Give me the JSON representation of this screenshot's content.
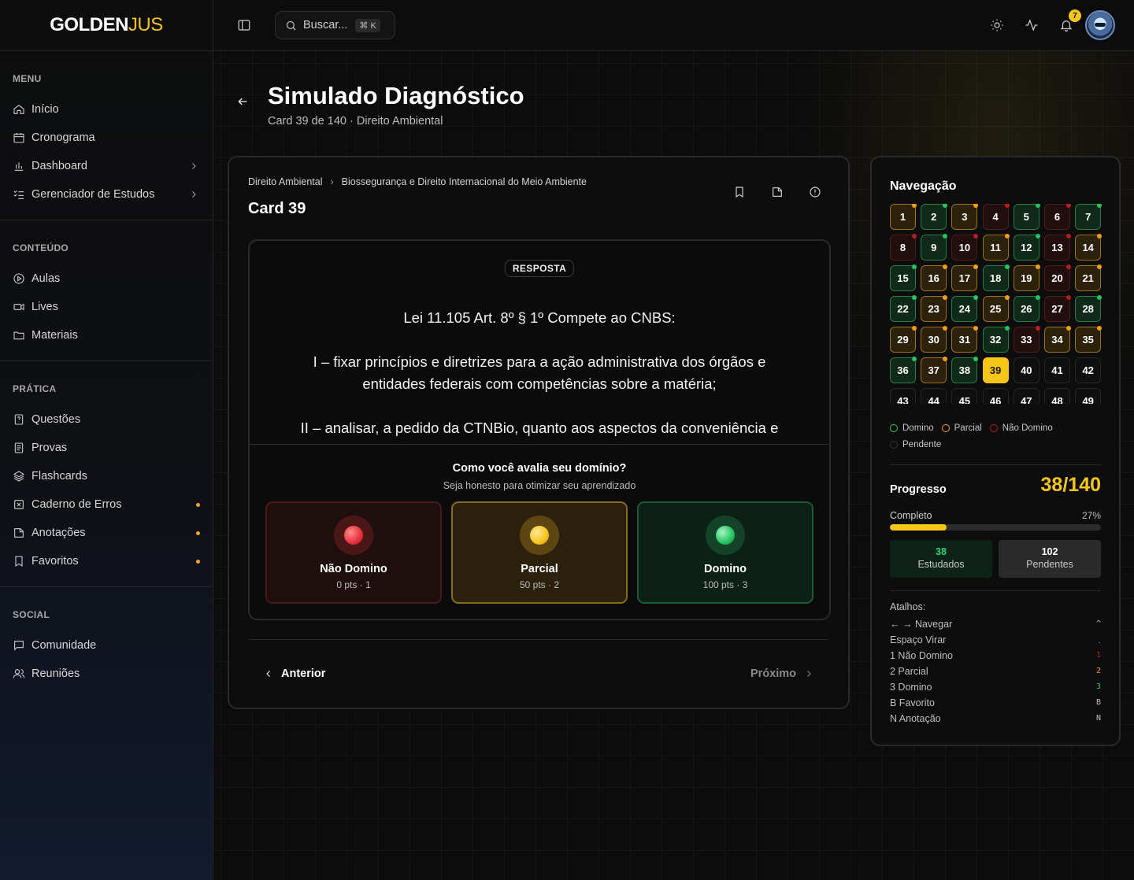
{
  "colors": {
    "accent": "#f5c518",
    "domino": "#22c55e",
    "parcial": "#f59e0b",
    "nao_domino": "#dc2626"
  },
  "logo": {
    "main": "GOLDEN",
    "accent": "JUS"
  },
  "sidebar": {
    "sections": [
      {
        "heading": "MENU",
        "items": [
          {
            "label": "Início",
            "icon": "home-icon"
          },
          {
            "label": "Cronograma",
            "icon": "calendar-icon"
          },
          {
            "label": "Dashboard",
            "icon": "bar-chart-icon",
            "chevron": true
          },
          {
            "label": "Gerenciador de Estudos",
            "icon": "list-check-icon",
            "chevron": true
          }
        ]
      },
      {
        "heading": "CONTEÚDO",
        "items": [
          {
            "label": "Aulas",
            "icon": "play-circle-icon"
          },
          {
            "label": "Lives",
            "icon": "video-icon"
          },
          {
            "label": "Materiais",
            "icon": "folder-icon"
          }
        ]
      },
      {
        "heading": "PRÁTICA",
        "items": [
          {
            "label": "Questões",
            "icon": "question-file-icon"
          },
          {
            "label": "Provas",
            "icon": "exam-icon"
          },
          {
            "label": "Flashcards",
            "icon": "layers-icon"
          },
          {
            "label": "Caderno de Erros",
            "icon": "x-square-icon",
            "dot": true
          },
          {
            "label": "Anotações",
            "icon": "note-icon",
            "dot": true
          },
          {
            "label": "Favoritos",
            "icon": "bookmark-icon",
            "dot": true
          }
        ]
      },
      {
        "heading": "SOCIAL",
        "items": [
          {
            "label": "Comunidade",
            "icon": "message-square-icon"
          },
          {
            "label": "Reuniões",
            "icon": "users-icon"
          }
        ]
      }
    ]
  },
  "topbar": {
    "search_placeholder": "Buscar...",
    "search_shortcut": "⌘ K",
    "notification_count": "7"
  },
  "header": {
    "title": "Simulado Diagnóstico",
    "subtitle": "Card 39 de 140  · Direito Ambiental"
  },
  "card": {
    "breadcrumb": [
      "Direito Ambiental",
      "Biossegurança e Direito Internacional do Meio Ambiente"
    ],
    "title": "Card 39",
    "answer_label": "RESPOSTA",
    "answer_paragraphs": [
      "Lei 11.105 Art. 8º § 1º Compete ao CNBS:",
      "I – fixar princípios e diretrizes para a ação administrativa dos órgãos e entidades federais com competências sobre a matéria;",
      "II – analisar, a pedido da CTNBio, quanto aos aspectos da conveniência e oportunidade socioeconômicas e do interesse nacional, os pedidos de liberação"
    ],
    "rating": {
      "question": "Como você avalia seu domínio?",
      "hint": "Seja honesto para otimizar seu aprendizado",
      "options": [
        {
          "label": "Não Domino",
          "sub": "0 pts · 1"
        },
        {
          "label": "Parcial",
          "sub": "50 pts · 2"
        },
        {
          "label": "Domino",
          "sub": "100 pts · 3"
        }
      ]
    },
    "prev_label": "Anterior",
    "next_label": "Próximo"
  },
  "navigation": {
    "title": "Navegação",
    "current": 39,
    "cells": [
      {
        "n": "1",
        "s": "p",
        "d": "p"
      },
      {
        "n": "2",
        "s": "d",
        "d": "d"
      },
      {
        "n": "3",
        "s": "p",
        "d": "p"
      },
      {
        "n": "4",
        "s": "n",
        "d": "n"
      },
      {
        "n": "5",
        "s": "d",
        "d": "d"
      },
      {
        "n": "6",
        "s": "n",
        "d": "n"
      },
      {
        "n": "7",
        "s": "d",
        "d": "d"
      },
      {
        "n": "8",
        "s": "n",
        "d": "n"
      },
      {
        "n": "9",
        "s": "d",
        "d": "d"
      },
      {
        "n": "10",
        "s": "n",
        "d": "n"
      },
      {
        "n": "11",
        "s": "p",
        "d": "p"
      },
      {
        "n": "12",
        "s": "d",
        "d": "d"
      },
      {
        "n": "13",
        "s": "n",
        "d": "n"
      },
      {
        "n": "14",
        "s": "p",
        "d": "p"
      },
      {
        "n": "15",
        "s": "d",
        "d": "d"
      },
      {
        "n": "16",
        "s": "p",
        "d": "p"
      },
      {
        "n": "17",
        "s": "p",
        "d": "p"
      },
      {
        "n": "18",
        "s": "d",
        "d": "d"
      },
      {
        "n": "19",
        "s": "p",
        "d": "p"
      },
      {
        "n": "20",
        "s": "n",
        "d": "n"
      },
      {
        "n": "21",
        "s": "p",
        "d": "p"
      },
      {
        "n": "22",
        "s": "d",
        "d": "d"
      },
      {
        "n": "23",
        "s": "p",
        "d": "p"
      },
      {
        "n": "24",
        "s": "d",
        "d": "d"
      },
      {
        "n": "25",
        "s": "p",
        "d": "p"
      },
      {
        "n": "26",
        "s": "d",
        "d": "d"
      },
      {
        "n": "27",
        "s": "n",
        "d": "n"
      },
      {
        "n": "28",
        "s": "d",
        "d": "d"
      },
      {
        "n": "29",
        "s": "p",
        "d": "p"
      },
      {
        "n": "30",
        "s": "p",
        "d": "p"
      },
      {
        "n": "31",
        "s": "p",
        "d": "p"
      },
      {
        "n": "32",
        "s": "d",
        "d": "d"
      },
      {
        "n": "33",
        "s": "n",
        "d": "n"
      },
      {
        "n": "34",
        "s": "p",
        "d": "p"
      },
      {
        "n": "35",
        "s": "p",
        "d": "p"
      },
      {
        "n": "36",
        "s": "d",
        "d": "d"
      },
      {
        "n": "37",
        "s": "p",
        "d": "p"
      },
      {
        "n": "38",
        "s": "d",
        "d": "d"
      },
      {
        "n": "39",
        "s": "cur",
        "d": ""
      },
      {
        "n": "40",
        "s": "e",
        "d": ""
      },
      {
        "n": "41",
        "s": "e",
        "d": ""
      },
      {
        "n": "42",
        "s": "e",
        "d": ""
      },
      {
        "n": "43",
        "s": "e",
        "d": ""
      },
      {
        "n": "44",
        "s": "e",
        "d": ""
      },
      {
        "n": "45",
        "s": "e",
        "d": ""
      },
      {
        "n": "46",
        "s": "e",
        "d": ""
      },
      {
        "n": "47",
        "s": "e",
        "d": ""
      },
      {
        "n": "48",
        "s": "e",
        "d": ""
      },
      {
        "n": "49",
        "s": "e",
        "d": ""
      }
    ],
    "legend": [
      {
        "label": "Domino",
        "color": "#22c55e"
      },
      {
        "label": "Parcial",
        "color": "#f59e0b"
      },
      {
        "label": "Não Domino",
        "color": "#b91c1c"
      },
      {
        "label": "Pendente",
        "color": "#333333"
      }
    ],
    "progress_label": "Progresso",
    "progress_value": "38/140",
    "complete_label": "Completo",
    "complete_pct": "27%",
    "complete_fraction": 0.27,
    "studied_count": "38",
    "studied_label": "Estudados",
    "pending_count": "102",
    "pending_label": "Pendentes",
    "shortcuts_heading": "Atalhos:",
    "shortcuts": [
      {
        "label": "← → Navegar",
        "key": "^",
        "color": "#bfbfbf"
      },
      {
        "label": "Espaço Virar",
        "key": "˯",
        "color": "#bfbfbf"
      },
      {
        "label": "1 Não Domino",
        "key": "1",
        "color": "#b91c1c"
      },
      {
        "label": "2 Parcial",
        "key": "2",
        "color": "#f59e0b"
      },
      {
        "label": "3 Domino",
        "key": "3",
        "color": "#22c55e"
      },
      {
        "label": "B Favorito",
        "key": "B",
        "color": "#bfbfbf"
      },
      {
        "label": "N Anotação",
        "key": "N",
        "color": "#bfbfbf"
      }
    ]
  }
}
